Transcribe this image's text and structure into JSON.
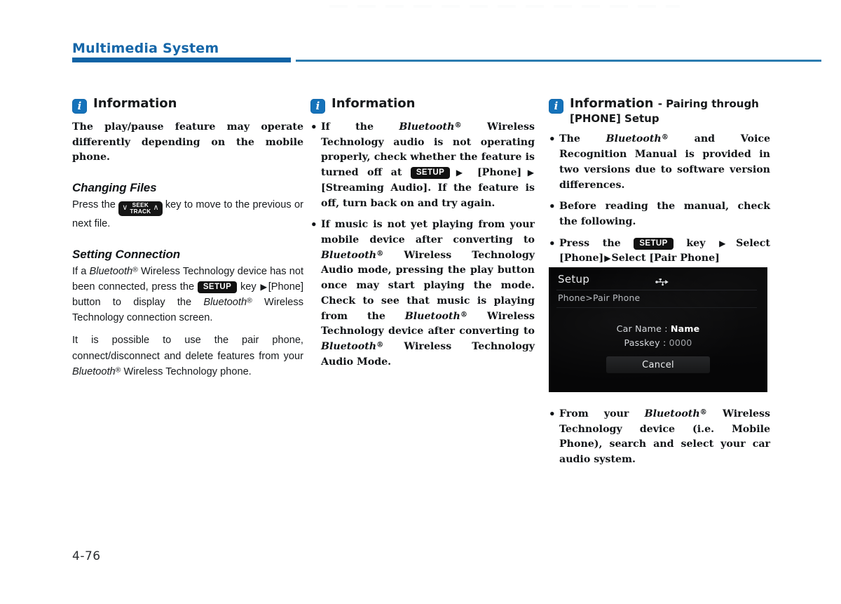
{
  "header": {
    "title": "Multimedia System",
    "accent_color": "#0f63a5",
    "rule_thin_color": "#2b7cb0"
  },
  "footer": {
    "page_number": "4-76"
  },
  "icons": {
    "info": "info-icon",
    "usb": "usb-icon",
    "arrow": "▶",
    "chevron_down": "∨",
    "chevron_up": "∧"
  },
  "keys": {
    "setup": "SETUP",
    "seek_line1": "SEEK",
    "seek_line2": "TRACK"
  },
  "column1": {
    "info_title": "Information",
    "intro": "The play/pause feature may operate differently depending on the mobile phone.",
    "section1": {
      "heading": "Changing Files",
      "text_before_key": "Press the",
      "text_after_key": "key to move to the previous or next file."
    },
    "section2": {
      "heading": "Setting Connection",
      "p1_a": "If a",
      "p1_bt": "Bluetooth",
      "p1_b": "Wireless Technology device has not been connected, press the",
      "p1_c": "key",
      "p1_d": "[Phone] button to display the",
      "p1_bt2": "Bluetooth",
      "p1_e": "Wireless Technology connection screen.",
      "p2_a": "It is possible to use the pair phone, connect/disconnect and delete features from your",
      "p2_bt": "Bluetooth",
      "p2_b": "Wireless Technology phone."
    }
  },
  "column2": {
    "info_title": "Information",
    "bullets": [
      {
        "a": "If the",
        "bt": "Bluetooth",
        "b": "Wireless Technology audio is not operating properly, check whether the feature is turned off at",
        "c": "[Phone]",
        "d": "[Streaming Audio]. If the feature is off, turn back on and try again."
      },
      {
        "a": "If music is not yet playing from your mobile device after converting to",
        "bt": "Bluetooth",
        "b": "Wireless Technology Audio mode, pressing the play button once may start playing the mode. Check to see that music is playing from the",
        "bt2": "Bluetooth",
        "c": "Wireless Technology device after converting to",
        "bt3": "Bluetooth",
        "d": "Wireless Technology Audio Mode."
      }
    ]
  },
  "column3": {
    "info_title": "Information",
    "info_subtitle_line1": "- Pairing through",
    "info_subtitle_line2": "[PHONE] Setup",
    "bullets": [
      {
        "a": "The",
        "bt": "Bluetooth",
        "b": "and Voice Recognition Manual is provided in two versions due to software version differences."
      },
      {
        "a": "Before reading the manual, check the following."
      },
      {
        "a": "Press the",
        "b": "key",
        "c": "Select [Phone]",
        "d": "Select [Pair Phone]"
      },
      {
        "a": "From your",
        "bt": "Bluetooth",
        "b": "Wireless Technology device (i.e. Mobile Phone), search and select your car audio system."
      }
    ],
    "device_screen": {
      "title": "Setup",
      "breadcrumb": "Phone>Pair Phone",
      "rows": [
        {
          "label": "Car Name :",
          "value": "Name"
        },
        {
          "label": "Passkey :",
          "value": "0000"
        }
      ],
      "cancel_label": "Cancel"
    }
  }
}
